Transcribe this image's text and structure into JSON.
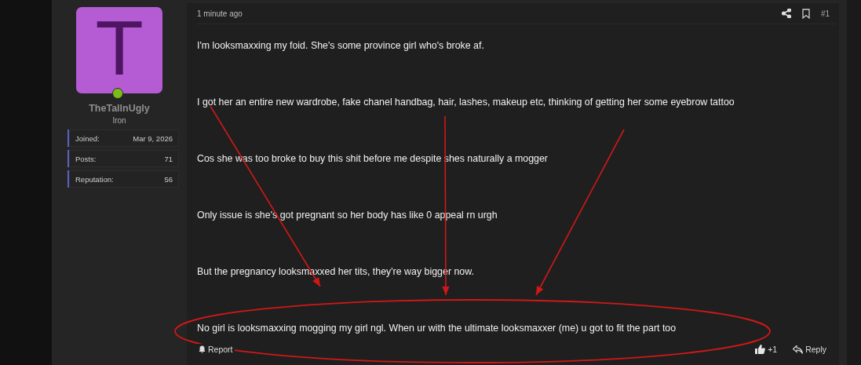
{
  "post": {
    "time": "1 minute ago",
    "number": "#1",
    "author": {
      "avatar_letter": "T",
      "online": true,
      "name": "TheTallnUgly",
      "rank": "Iron",
      "stats": [
        {
          "label": "Joined:",
          "value": "Mar 9, 2026"
        },
        {
          "label": "Posts:",
          "value": "71"
        },
        {
          "label": "Reputation:",
          "value": "56"
        }
      ]
    },
    "paragraphs": [
      "I'm looksmaxxing my foid. She's some province girl who's broke af.",
      "I got her an entire new wardrobe, fake chanel handbag, hair, lashes, makeup etc, thinking of getting her some eyebrow tattoo",
      "Cos she was too broke to buy this shit before me despite shes naturally a mogger",
      "Only issue is she's got pregnant so her body has like 0 appeal rn urgh",
      "But the pregnancy looksmaxxed her tits, they're way bigger now.",
      "No girl is looksmaxxing mogging my girl ngl. When ur with the ultimate looksmaxxer (me) u got to fit the part too"
    ],
    "report": "Report",
    "likes": "+1",
    "reply": "Reply"
  },
  "annotations": [
    {
      "kind": "arrow"
    },
    {
      "kind": "arrow"
    },
    {
      "kind": "arrow"
    },
    {
      "kind": "ellipse"
    }
  ]
}
